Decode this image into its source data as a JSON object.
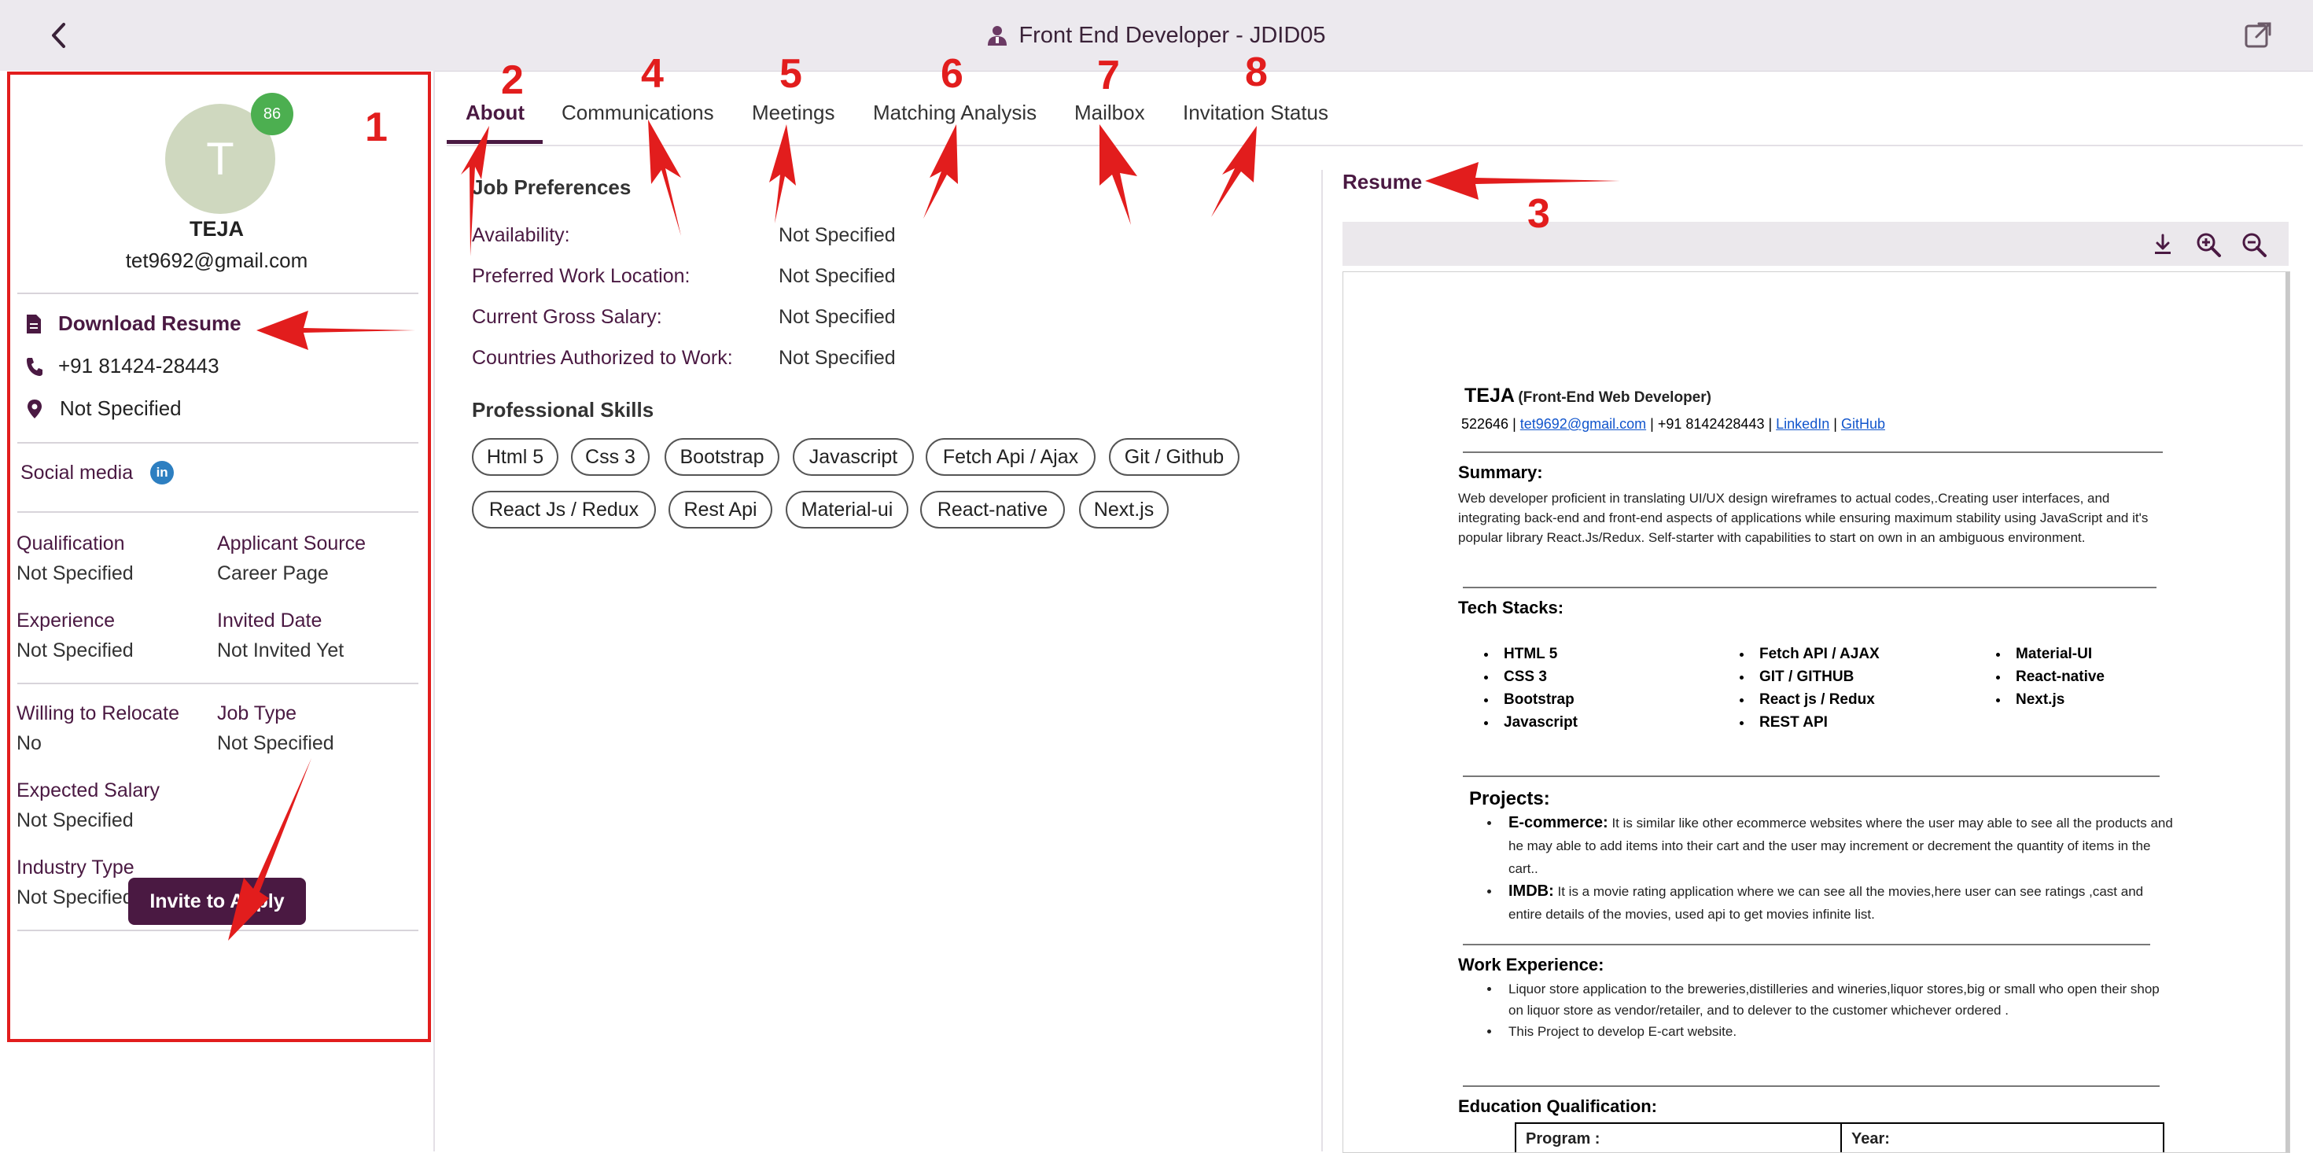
{
  "header": {
    "title": "Front End Developer - JDID05",
    "back_icon": "back-chevron-icon",
    "open_icon": "external-link-icon"
  },
  "candidate": {
    "initial": "T",
    "score": "86",
    "name": "TEJA",
    "email": "tet9692@gmail.com",
    "download_label": "Download Resume",
    "phone": "+91 81424-28443",
    "location": "Not Specified",
    "social_label": "Social media",
    "social_icon_text": "in"
  },
  "fields": {
    "qualification": {
      "label": "Qualification",
      "value": "Not Specified"
    },
    "applicant_source": {
      "label": "Applicant Source",
      "value": "Career Page"
    },
    "experience": {
      "label": "Experience",
      "value": "Not Specified"
    },
    "invited_date": {
      "label": "Invited Date",
      "value": "Not Invited Yet"
    },
    "relocate": {
      "label": "Willing to Relocate",
      "value": "No"
    },
    "job_type": {
      "label": "Job Type",
      "value": "Not Specified"
    },
    "expected_salary": {
      "label": "Expected Salary",
      "value": "Not Specified"
    },
    "industry_type": {
      "label": "Industry Type",
      "value": "Not Specified"
    }
  },
  "invite_button": "Invite to Apply",
  "tabs": [
    {
      "label": "About"
    },
    {
      "label": "Communications"
    },
    {
      "label": "Meetings"
    },
    {
      "label": "Matching Analysis"
    },
    {
      "label": "Mailbox"
    },
    {
      "label": "Invitation Status"
    }
  ],
  "about": {
    "job_preferences_title": "Job Preferences",
    "preferences": [
      {
        "label": "Availability:",
        "value": "Not Specified"
      },
      {
        "label": "Preferred Work Location:",
        "value": "Not Specified"
      },
      {
        "label": "Current Gross Salary:",
        "value": "Not Specified"
      },
      {
        "label": "Countries Authorized to Work:",
        "value": "Not Specified"
      }
    ],
    "skills_title": "Professional Skills",
    "skills": [
      "Html 5",
      "Css 3",
      "Bootstrap",
      "Javascript",
      "Fetch Api / Ajax",
      "Git / Github",
      "React Js / Redux",
      "Rest Api",
      "Material-ui",
      "React-native",
      "Next.js"
    ]
  },
  "resume": {
    "title": "Resume",
    "name": "TEJA",
    "subtitle": "(Front-End Web Developer)",
    "contact_prefix": "522646 |",
    "email": "tet9692@gmail.com",
    "phone_mid": "| +91 8142428443 |",
    "linkedin": "LinkedIn",
    "sep": "|",
    "github": "GitHub",
    "summary_title": "Summary:",
    "summary": "Web developer proficient in translating UI/UX design wireframes to actual codes,.Creating user interfaces, and integrating back-end and front-end aspects of applications while ensuring maximum stability using JavaScript and it's popular library React.Js/Redux. Self-starter with capabilities to start on own in an ambiguous environment.",
    "tech_title": "Tech Stacks:",
    "tech_col1": [
      "HTML 5",
      "CSS 3",
      "Bootstrap",
      "Javascript"
    ],
    "tech_col2": [
      "Fetch API / AJAX",
      "GIT / GITHUB",
      "React js / Redux",
      "REST API"
    ],
    "tech_col3": [
      "Material-UI",
      "React-native",
      "Next.js"
    ],
    "projects_title": "Projects:",
    "projects": [
      {
        "name": "E-commerce:",
        "text": "It is similar like other ecommerce websites where the user may able to see all the products and he may able to add items into their cart and the user may increment or decrement the quantity of items in the cart.."
      },
      {
        "name": "IMDB:",
        "text": "It is a movie rating application where we can see all the movies,here user can see ratings ,cast and entire details of the movies, used api to get movies infinite list."
      }
    ],
    "work_title": "Work Experience:",
    "work": [
      "Liquor store application to the breweries,distilleries and wineries,liquor stores,big or small who open their shop on liquor store as vendor/retailer, and  to delever to the customer whichever ordered .",
      "This Project to develop E-cart website."
    ],
    "education_title": "Education Qualification:",
    "edu_col1": "Program :",
    "edu_col2": "Year:",
    "tools": {
      "download_icon": "download-icon",
      "zoom_in_icon": "zoom-in-icon",
      "zoom_out_icon": "zoom-out-icon"
    }
  },
  "annotations": [
    "1",
    "2",
    "3",
    "4",
    "5",
    "6",
    "7",
    "8"
  ],
  "colors": {
    "accent": "#4a1942",
    "annotation": "#e21d1d",
    "score_badge": "#4caf50",
    "linkedin": "#2d7fc1"
  }
}
